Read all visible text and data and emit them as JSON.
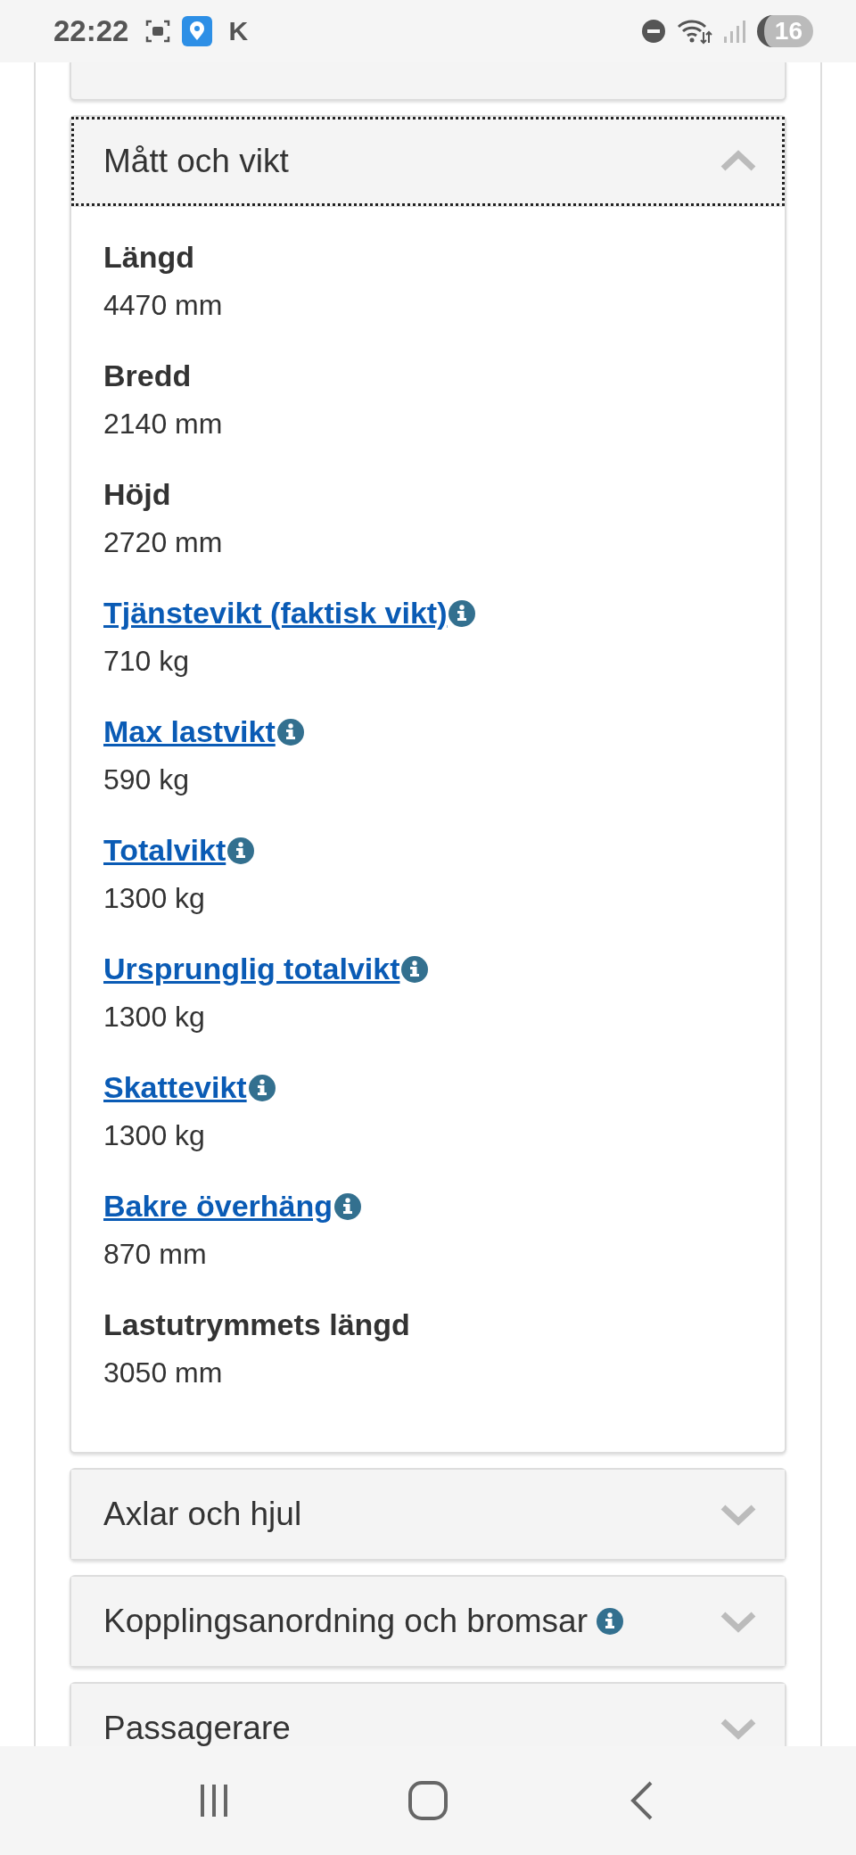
{
  "status_bar": {
    "time": "22:22",
    "app_letter": "K",
    "battery": "16"
  },
  "panels": [
    {
      "title": "Mått och vikt",
      "expanded": true,
      "info": false,
      "focused": true,
      "items": [
        {
          "kind": "plain",
          "label": "Längd",
          "value": "4470 mm"
        },
        {
          "kind": "plain",
          "label": "Bredd",
          "value": "2140 mm"
        },
        {
          "kind": "plain",
          "label": "Höjd",
          "value": "2720 mm"
        },
        {
          "kind": "link",
          "label": "Tjänstevikt (faktisk vikt)",
          "value": "710 kg"
        },
        {
          "kind": "link",
          "label": "Max lastvikt",
          "value": "590 kg"
        },
        {
          "kind": "link",
          "label": "Totalvikt",
          "value": "1300 kg"
        },
        {
          "kind": "link",
          "label": "Ursprunglig totalvikt",
          "value": "1300 kg"
        },
        {
          "kind": "link",
          "label": "Skattevikt",
          "value": "1300 kg"
        },
        {
          "kind": "link",
          "label": "Bakre överhäng",
          "value": "870 mm"
        },
        {
          "kind": "plain",
          "label": "Lastutrymmets längd",
          "value": "3050 mm"
        }
      ]
    },
    {
      "title": "Axlar och hjul",
      "expanded": false,
      "info": false,
      "focused": false
    },
    {
      "title": "Kopplingsanordning och bromsar",
      "expanded": false,
      "info": true,
      "focused": false
    },
    {
      "title": "Passagerare",
      "expanded": false,
      "info": false,
      "focused": false
    }
  ]
}
